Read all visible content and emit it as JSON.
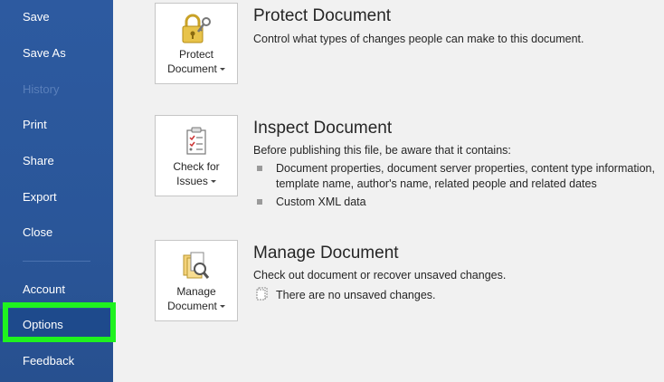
{
  "sidebar": {
    "items": [
      {
        "label": "Save",
        "enabled": true
      },
      {
        "label": "Save As",
        "enabled": true
      },
      {
        "label": "History",
        "enabled": false
      },
      {
        "label": "Print",
        "enabled": true
      },
      {
        "label": "Share",
        "enabled": true
      },
      {
        "label": "Export",
        "enabled": true
      },
      {
        "label": "Close",
        "enabled": true
      },
      {
        "label": "Account",
        "enabled": true
      },
      {
        "label": "Options",
        "enabled": true,
        "highlighted": true
      },
      {
        "label": "Feedback",
        "enabled": true
      }
    ],
    "bg_color": "#2b579a",
    "highlight_color": "#1ff21f"
  },
  "protect": {
    "button_line1": "Protect",
    "button_line2": "Document",
    "title": "Protect Document",
    "description": "Control what types of changes people can make to this document.",
    "icon": "lock-key-icon"
  },
  "inspect": {
    "button_line1": "Check for",
    "button_line2": "Issues",
    "title": "Inspect Document",
    "description": "Before publishing this file, be aware that it contains:",
    "bullets": [
      "Document properties, document server properties, content type information,",
      "template name, author's name, related people and related dates",
      "Custom XML data"
    ],
    "icon": "checklist-icon"
  },
  "manage": {
    "button_line1": "Manage",
    "button_line2": "Document",
    "title": "Manage Document",
    "description": "Check out document or recover unsaved changes.",
    "note": "There are no unsaved changes.",
    "icon": "document-search-icon"
  }
}
